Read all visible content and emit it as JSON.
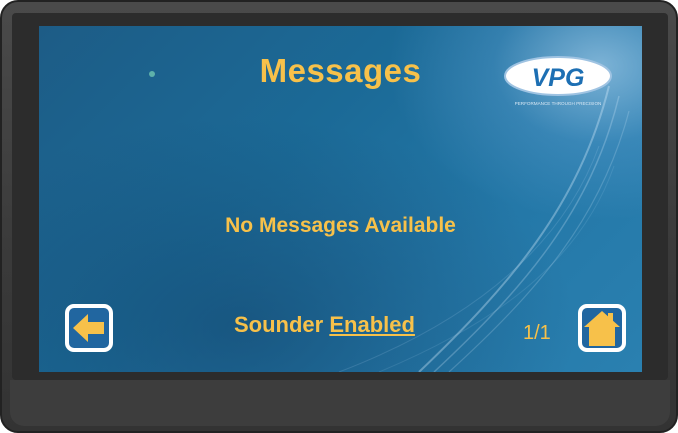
{
  "screen": {
    "title": "Messages",
    "logo": {
      "wordmark": "VPG",
      "tagline": "PERFORMANCE THROUGH PRECISION",
      "color": "#1d6fb3"
    },
    "message": "No Messages Available",
    "sounder": {
      "label": "Sounder",
      "state": "Enabled"
    },
    "page_indicator": "1/1",
    "back_button": {
      "icon": "left-arrow-icon"
    },
    "home_button": {
      "icon": "home-icon"
    }
  },
  "colors": {
    "text_accent": "#f7c14a",
    "button_border": "#ffffff",
    "screen_blue": "#1b6a97"
  }
}
